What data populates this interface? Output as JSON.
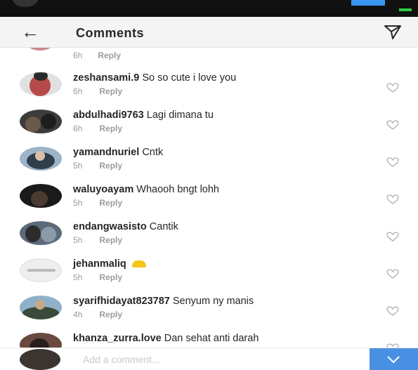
{
  "header": {
    "title": "Comments"
  },
  "partial_comment": {
    "time": "6h",
    "reply_label": "Reply"
  },
  "comments": [
    {
      "username": "zeshansami.9",
      "text": "So so cute i love you",
      "time": "6h",
      "reply_label": "Reply"
    },
    {
      "username": "abdulhadi9763",
      "text": "Lagi dimana tu",
      "time": "6h",
      "reply_label": "Reply"
    },
    {
      "username": "yamandnuriel",
      "text": "Cntk",
      "time": "5h",
      "reply_label": "Reply"
    },
    {
      "username": "waluyoayam",
      "text": "Whaooh  bngt lohh",
      "time": "5h",
      "reply_label": "Reply"
    },
    {
      "username": "endangwasisto",
      "text": "Cantik",
      "time": "5h",
      "reply_label": "Reply"
    },
    {
      "username": "jehanmaliq",
      "text": "",
      "time": "5h",
      "reply_label": "Reply"
    },
    {
      "username": "syarifhidayat823787",
      "text": "Senyum ny manis",
      "time": "4h",
      "reply_label": "Reply"
    },
    {
      "username": "khanza_zurra.love",
      "text": "Dan sehat anti darah",
      "time": "",
      "reply_label": ""
    }
  ],
  "add_comment": {
    "placeholder": "Add a comment..."
  },
  "colors": {
    "accent": "#4a90e2",
    "text": "#262626",
    "muted": "#9c9c9c"
  },
  "icons": {
    "back": "arrow-left-icon",
    "share": "paper-plane-icon",
    "like": "heart-outline-icon",
    "post": "check-icon"
  }
}
